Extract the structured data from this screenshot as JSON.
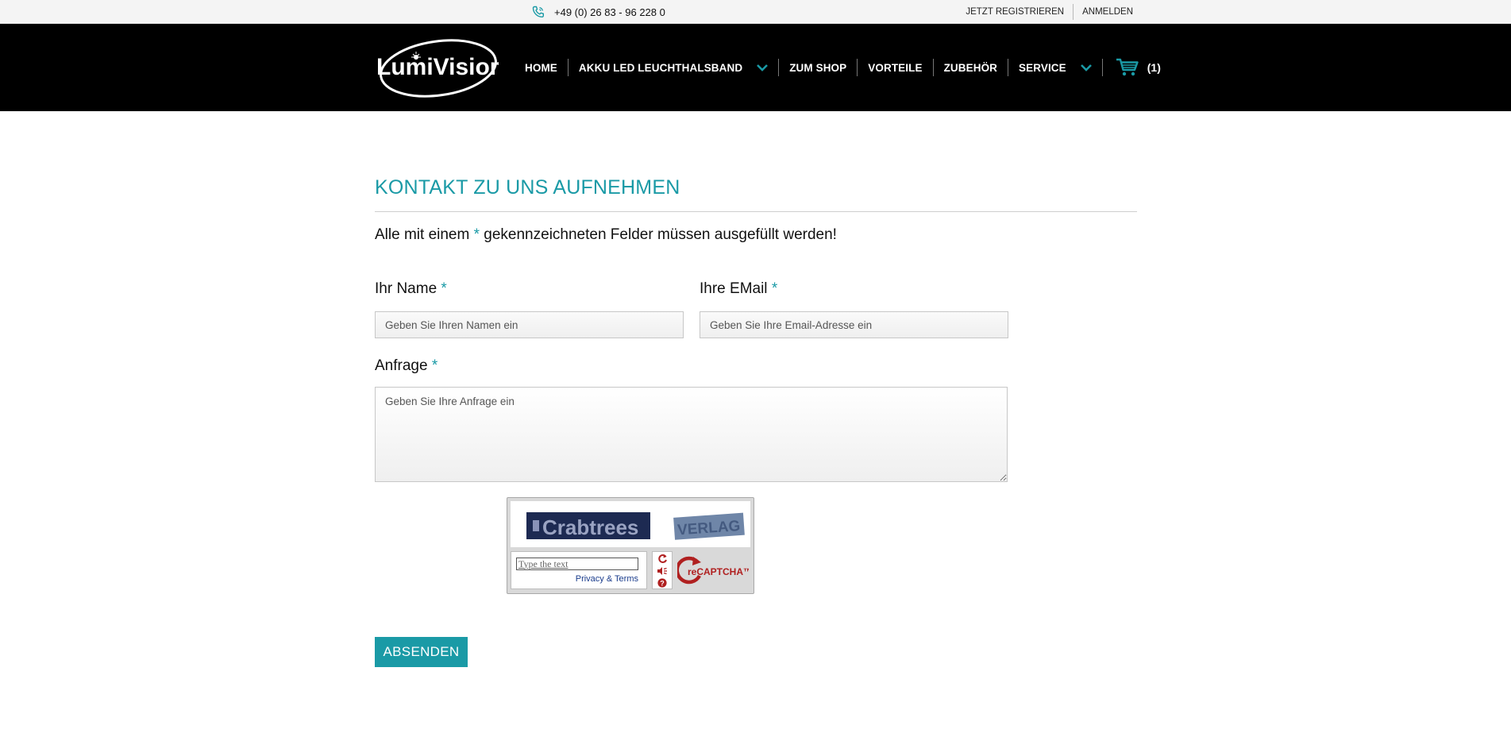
{
  "topbar": {
    "phone": "+49 (0) 26 83 - 96 228 0",
    "register": "JETZT REGISTRIEREN",
    "login": "ANMELDEN"
  },
  "header": {
    "logo_text": "LumiVision",
    "nav": [
      {
        "label": "HOME",
        "dropdown": false
      },
      {
        "label": "AKKU LED LEUCHTHALSBAND",
        "dropdown": true
      },
      {
        "label": "ZUM SHOP",
        "dropdown": false
      },
      {
        "label": "VORTEILE",
        "dropdown": false
      },
      {
        "label": "ZUBEHÖR",
        "dropdown": false
      },
      {
        "label": "SERVICE",
        "dropdown": true
      }
    ],
    "cart_count": "(1)"
  },
  "form": {
    "title": "KONTAKT ZU UNS AUFNEHMEN",
    "required_note_before": "Alle mit einem ",
    "required_star": "*",
    "required_note_after": " gekennzeichneten Felder müssen ausgefüllt werden!",
    "name_label": "Ihr Name ",
    "name_placeholder": "Geben Sie Ihren Namen ein",
    "email_label": "Ihre EMail ",
    "email_placeholder": "Geben Sie Ihre Email-Adresse ein",
    "request_label": "Anfrage ",
    "request_placeholder": "Geben Sie Ihre Anfrage ein",
    "submit_label": "ABSENDEN"
  },
  "captcha": {
    "word1": "Crabtrees",
    "word2": "VERLAG",
    "input_placeholder": "Type the text",
    "privacy": "Privacy & Terms",
    "brand": "reCAPTCHA™"
  },
  "colors": {
    "accent": "#1a9aa6",
    "header_bg": "#000000",
    "topbar_bg": "#f4f4f4"
  }
}
